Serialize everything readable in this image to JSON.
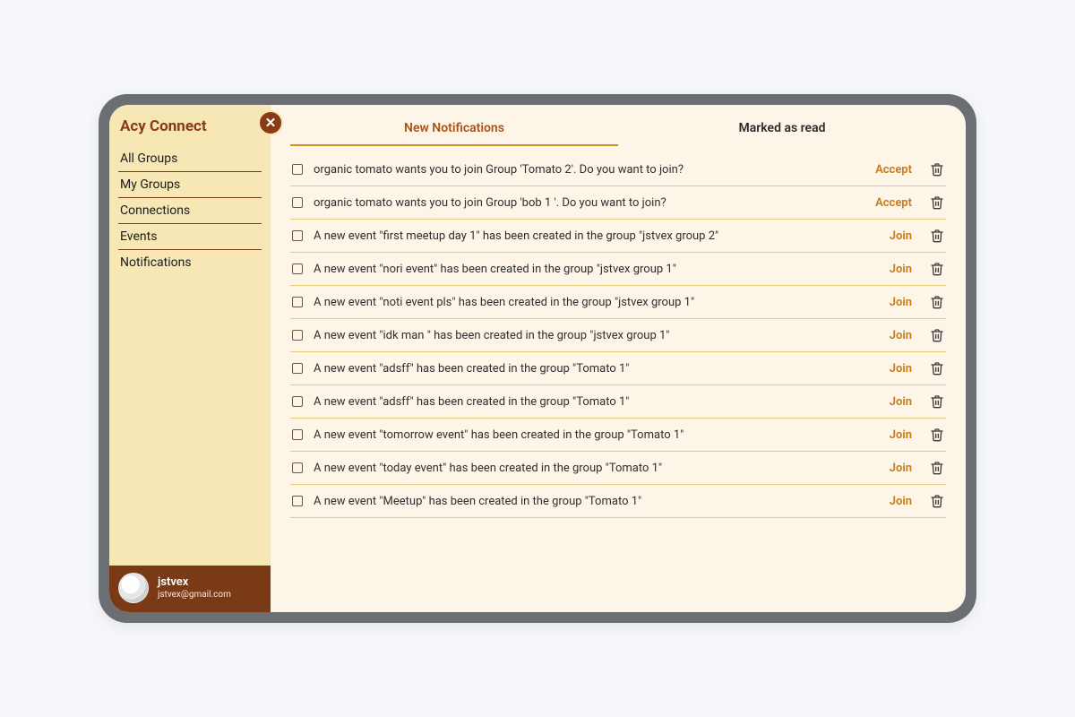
{
  "brand": "Acy Connect",
  "colors": {
    "accent": "#aa5217",
    "sidebar_bg": "#f7e7b4",
    "main_bg": "#fdf5e8",
    "action": "#c77a17"
  },
  "sidebar": {
    "items": [
      {
        "label": "All Groups"
      },
      {
        "label": "My Groups"
      },
      {
        "label": "Connections"
      },
      {
        "label": "Events"
      },
      {
        "label": "Notifications"
      }
    ]
  },
  "user": {
    "name": "jstvex",
    "email": "jstvex@gmail.com"
  },
  "tabs": [
    {
      "label": "New Notifications",
      "active": true
    },
    {
      "label": "Marked as read",
      "active": false
    }
  ],
  "notifications": [
    {
      "message": "organic tomato wants you to join Group 'Tomato 2'. Do you want to join?",
      "action": "Accept"
    },
    {
      "message": "organic tomato wants you to join Group 'bob 1 '. Do you want to join?",
      "action": "Accept"
    },
    {
      "message": "A new event \"first meetup day 1\" has been created in the group \"jstvex group 2\"",
      "action": "Join"
    },
    {
      "message": "A new event \"nori event\" has been created in the group \"jstvex group 1\"",
      "action": "Join"
    },
    {
      "message": "A new event \"noti event pls\" has been created in the group \"jstvex group 1\"",
      "action": "Join"
    },
    {
      "message": "A new event \"idk man \" has been created in the group \"jstvex group 1\"",
      "action": "Join"
    },
    {
      "message": "A new event \"adsff\" has been created in the group \"Tomato 1\"",
      "action": "Join"
    },
    {
      "message": "A new event \"adsff\" has been created in the group \"Tomato 1\"",
      "action": "Join"
    },
    {
      "message": "A new event \"tomorrow event\" has been created in the group \"Tomato 1\"",
      "action": "Join"
    },
    {
      "message": "A new event \"today event\" has been created in the group \"Tomato 1\"",
      "action": "Join"
    },
    {
      "message": "A new event \"Meetup\" has been created in the group \"Tomato 1\"",
      "action": "Join"
    }
  ]
}
